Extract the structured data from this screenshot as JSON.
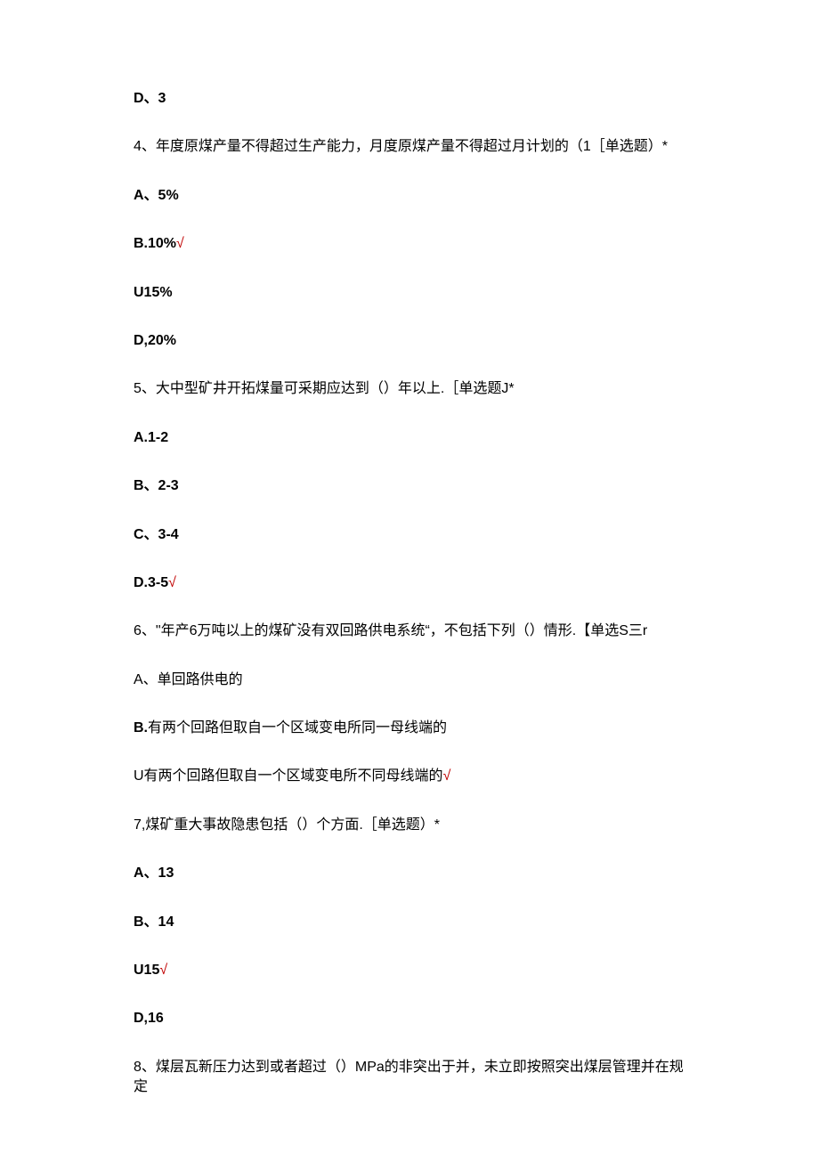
{
  "q3": {
    "opt_d": "D、3"
  },
  "q4": {
    "stem": "4、年度原煤产量不得超过生产能力，月度原煤产量不得超过月计划的（1［单选题）*",
    "opt_a": "A、5%",
    "opt_b_prefix": "B.10%",
    "opt_b_mark": "√",
    "opt_c": "U15%",
    "opt_d": "D,20%"
  },
  "q5": {
    "stem": "5、大中型矿井开拓煤量可采期应达到（）年以上.［单选题J*",
    "opt_a": "A.1-2",
    "opt_b": "B、2-3",
    "opt_c": "C、3-4",
    "opt_d_prefix": "D.3-5",
    "opt_d_mark": "√"
  },
  "q6": {
    "stem": "6、\"年产6万吨以上的煤矿没有双回路供电系统“，不包括下列（）情形.【单选S三r",
    "opt_a": "A、单回路供电的",
    "opt_b": "B.有两个回路但取自一个区域变电所同一母线端的",
    "opt_c_prefix": "U有两个回路但取自一个区域变电所不同母线端的",
    "opt_c_mark": "√"
  },
  "q7": {
    "stem": "7,煤矿重大事故隐患包括（）个方面.［单选题）*",
    "opt_a": "A、13",
    "opt_b": "B、14",
    "opt_c_prefix": "U15",
    "opt_c_mark": "√",
    "opt_d": "D,16"
  },
  "q8": {
    "stem": "8、煤层瓦新压力达到或者超过（）MPa的非突出于并，未立即按照突出煤层管理并在规定"
  }
}
